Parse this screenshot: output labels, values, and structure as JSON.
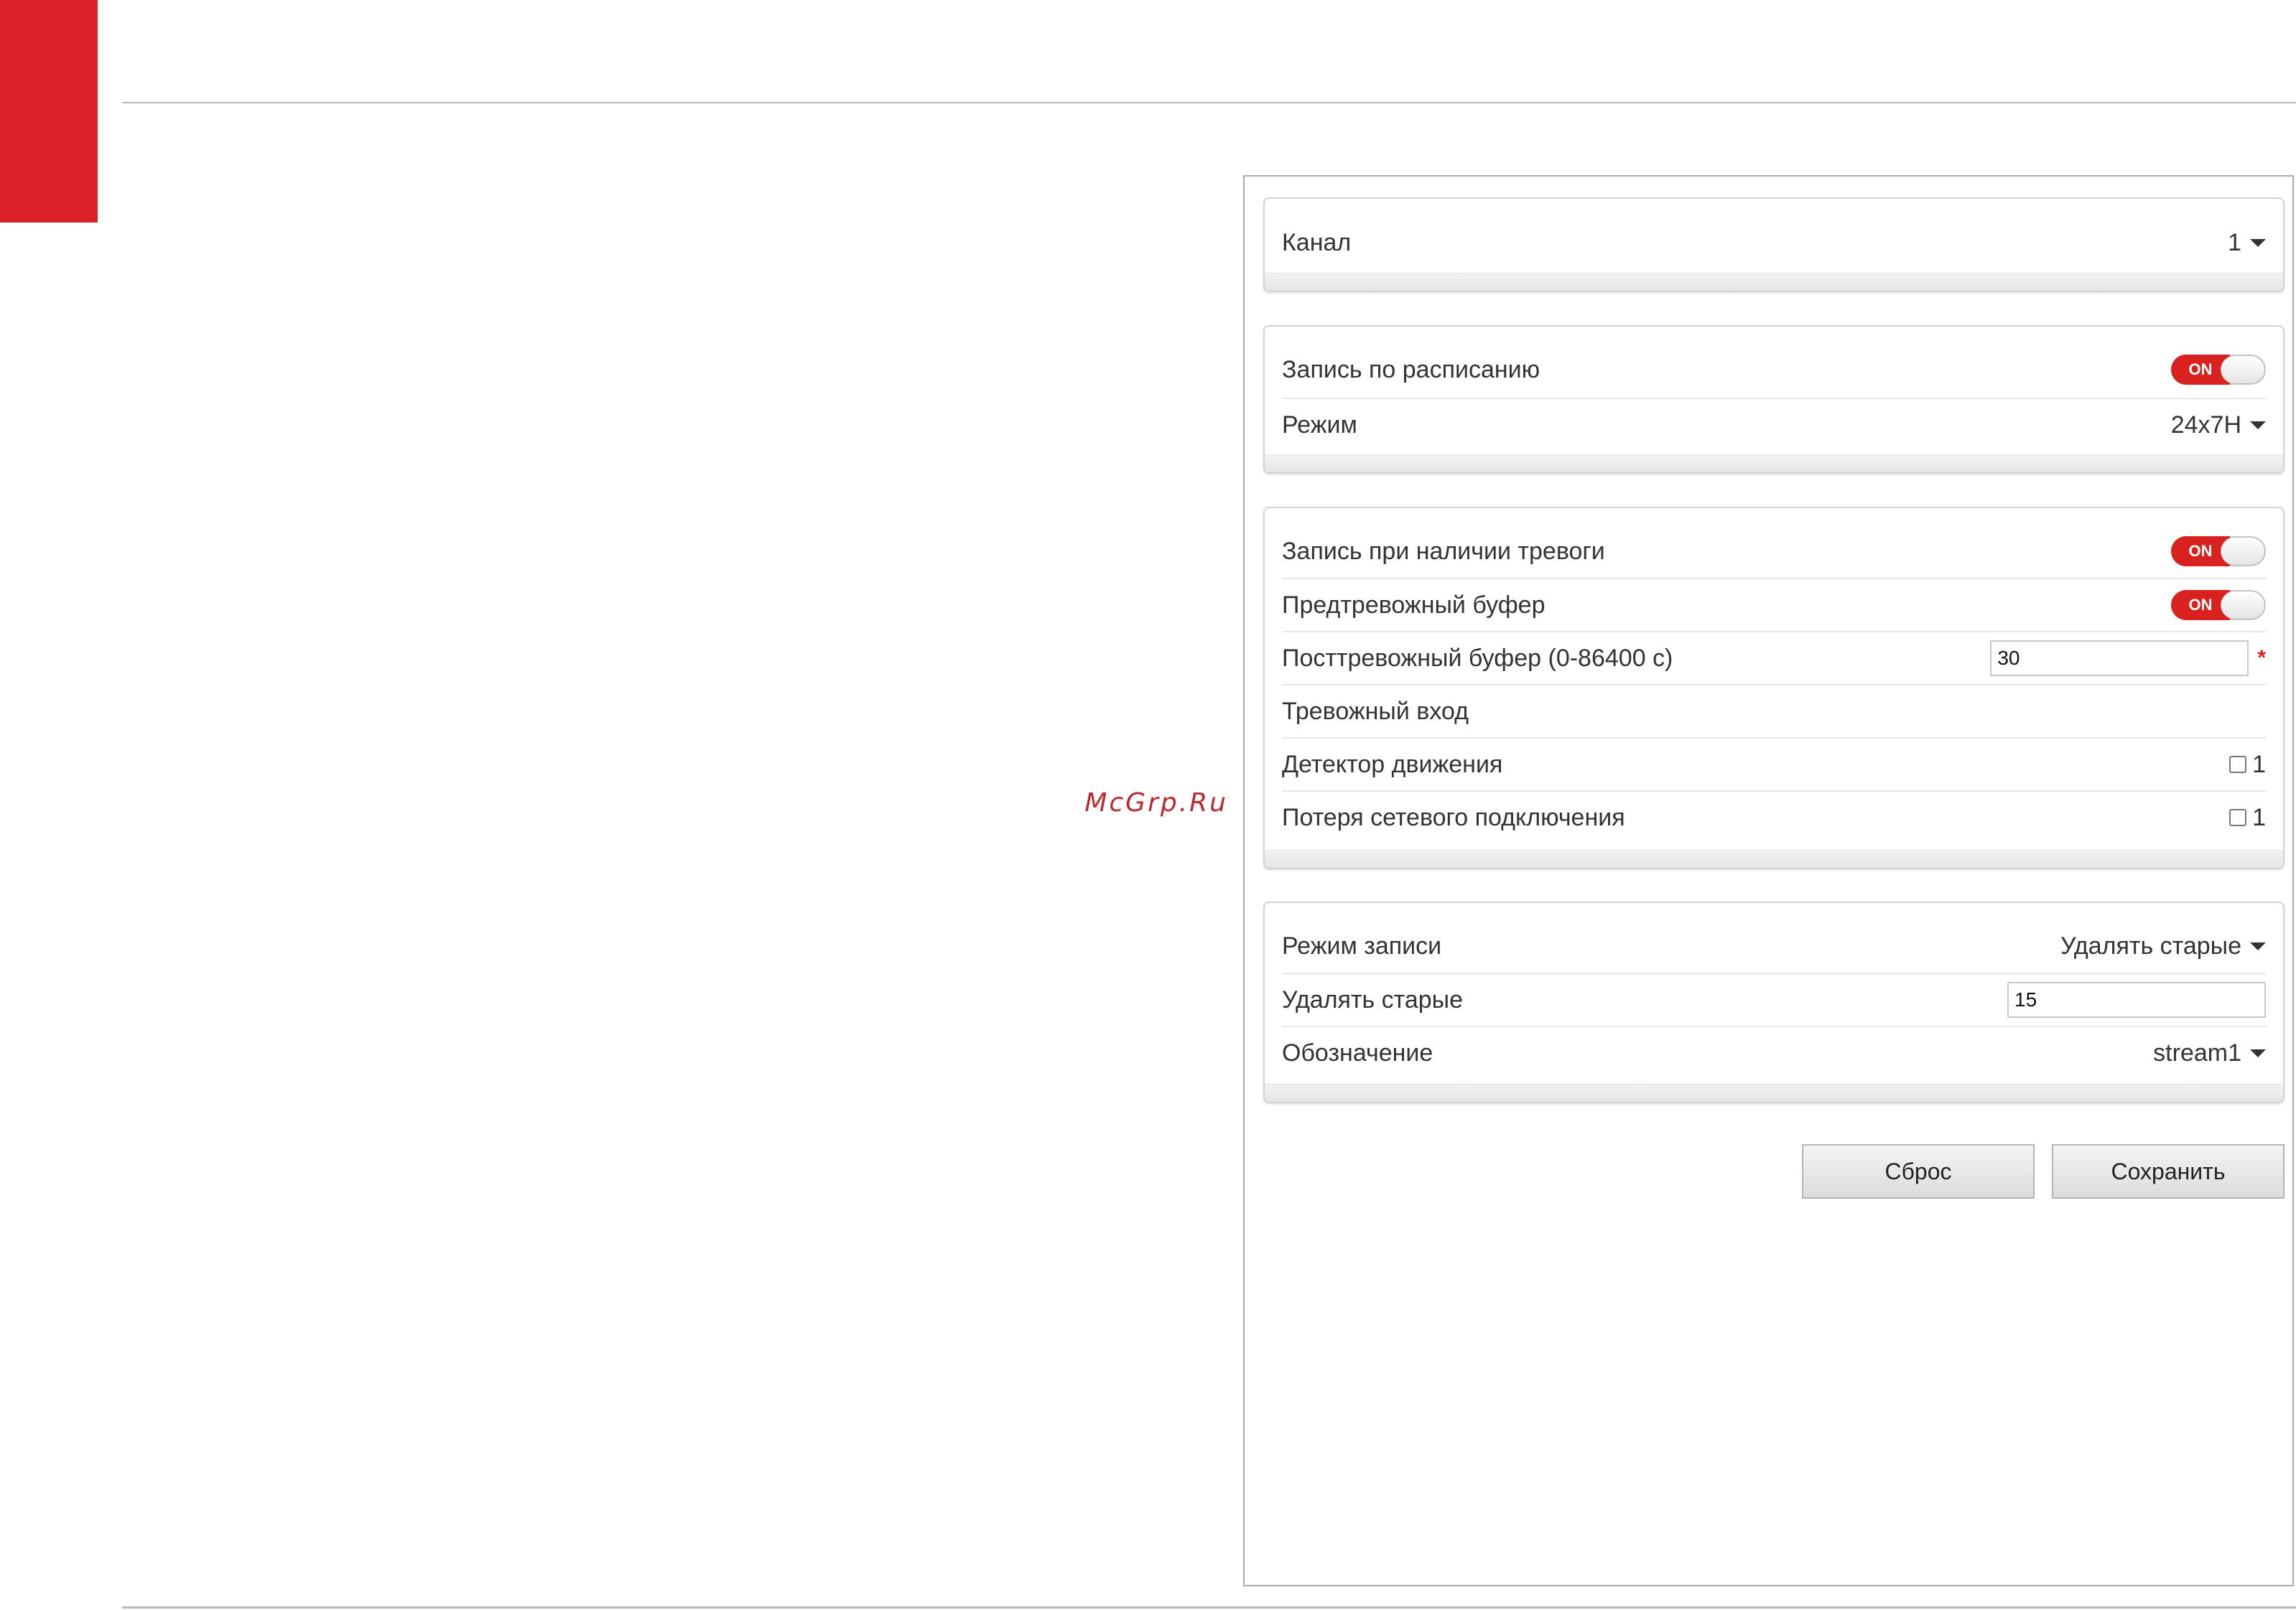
{
  "watermark": "McGrp.Ru",
  "channel_panel": {
    "label": "Канал",
    "value": "1"
  },
  "schedule_panel": {
    "schedule_record_label": "Запись по расписанию",
    "schedule_record_state": "ON",
    "mode_label": "Режим",
    "mode_value": "24x7H"
  },
  "alarm_panel": {
    "alarm_record_label": "Запись при наличии тревоги",
    "alarm_record_state": "ON",
    "prealarm_label": "Предтревожный буфер",
    "prealarm_state": "ON",
    "postalarm_label": "Посттревожный буфер (0-86400 с)",
    "postalarm_value": "30",
    "required_mark": "*",
    "alarm_input_label": "Тревожный вход",
    "motion_label": "Детектор движения",
    "motion_option": "1",
    "network_loss_label": "Потеря сетевого подключения",
    "network_loss_option": "1"
  },
  "storage_panel": {
    "record_mode_label": "Режим записи",
    "record_mode_value": "Удалять старые",
    "delete_old_label": "Удалять старые",
    "delete_old_value": "15",
    "stream_label": "Обозначение",
    "stream_value": "stream1"
  },
  "buttons": {
    "reset": "Сброс",
    "save": "Сохранить"
  },
  "colors": {
    "accent": "#db2128",
    "toggle_on": "#d9221f"
  },
  "icons": {
    "dropdown": "chevron-down-icon",
    "checkbox": "checkbox-icon"
  }
}
